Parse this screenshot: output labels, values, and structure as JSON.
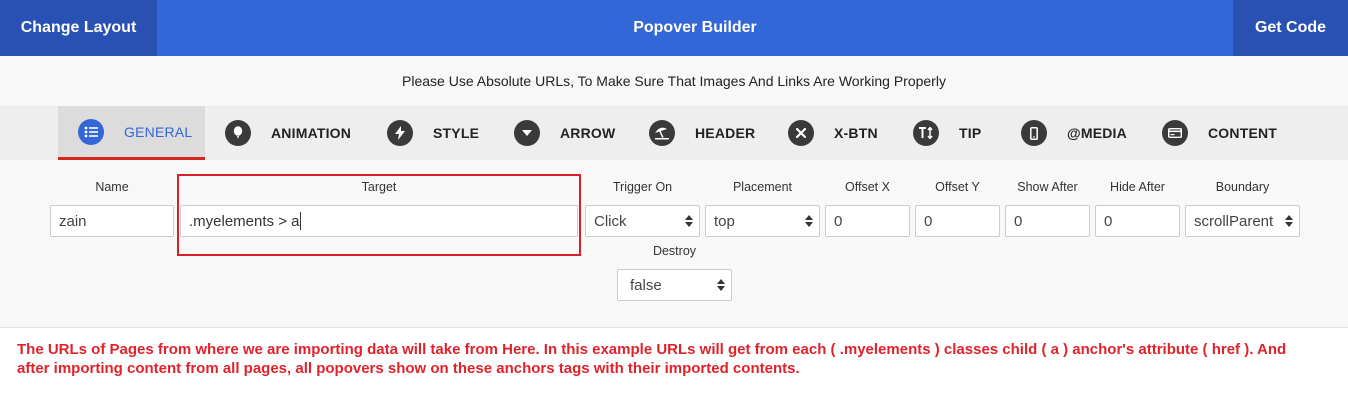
{
  "topbar": {
    "change_layout": "Change Layout",
    "title": "Popover Builder",
    "get_code": "Get Code"
  },
  "notice": "Please Use Absolute URLs, To Make Sure That Images And Links Are Working Properly",
  "tabs": [
    {
      "label": "GENERAL",
      "icon": "list-icon",
      "active": true
    },
    {
      "label": "ANIMATION",
      "icon": "balloon-icon"
    },
    {
      "label": "STYLE",
      "icon": "bolt-icon"
    },
    {
      "label": "ARROW",
      "icon": "caret-down-icon"
    },
    {
      "label": "HEADER",
      "icon": "umbrella-beach-icon"
    },
    {
      "label": "X-BTN",
      "icon": "close-icon"
    },
    {
      "label": "TIP",
      "icon": "text-height-icon"
    },
    {
      "label": "@MEDIA",
      "icon": "mobile-icon"
    },
    {
      "label": "CONTENT",
      "icon": "card-icon"
    }
  ],
  "form": {
    "name": {
      "label": "Name",
      "value": "zain"
    },
    "target": {
      "label": "Target",
      "value": ".myelements > a"
    },
    "trigger_on": {
      "label": "Trigger On",
      "value": "Click"
    },
    "placement": {
      "label": "Placement",
      "value": "top"
    },
    "offset_x": {
      "label": "Offset X",
      "value": "0"
    },
    "offset_y": {
      "label": "Offset Y",
      "value": "0"
    },
    "show_after": {
      "label": "Show After",
      "value": "0"
    },
    "hide_after": {
      "label": "Hide After",
      "value": "0"
    },
    "boundary": {
      "label": "Boundary",
      "value": "scrollParent"
    },
    "destroy": {
      "label": "Destroy",
      "value": "false"
    }
  },
  "colors": {
    "primary": "#3366d6",
    "primary_dark": "#2950b3",
    "annotation": "#e0232b"
  },
  "annotation_note": "The URLs of Pages from where we are importing data will take from Here. In this example URLs will get from each ( .myelements ) classes child ( a ) anchor's attribute ( href ). And after importing content from all pages, all popovers show on these anchors tags  with their imported contents."
}
